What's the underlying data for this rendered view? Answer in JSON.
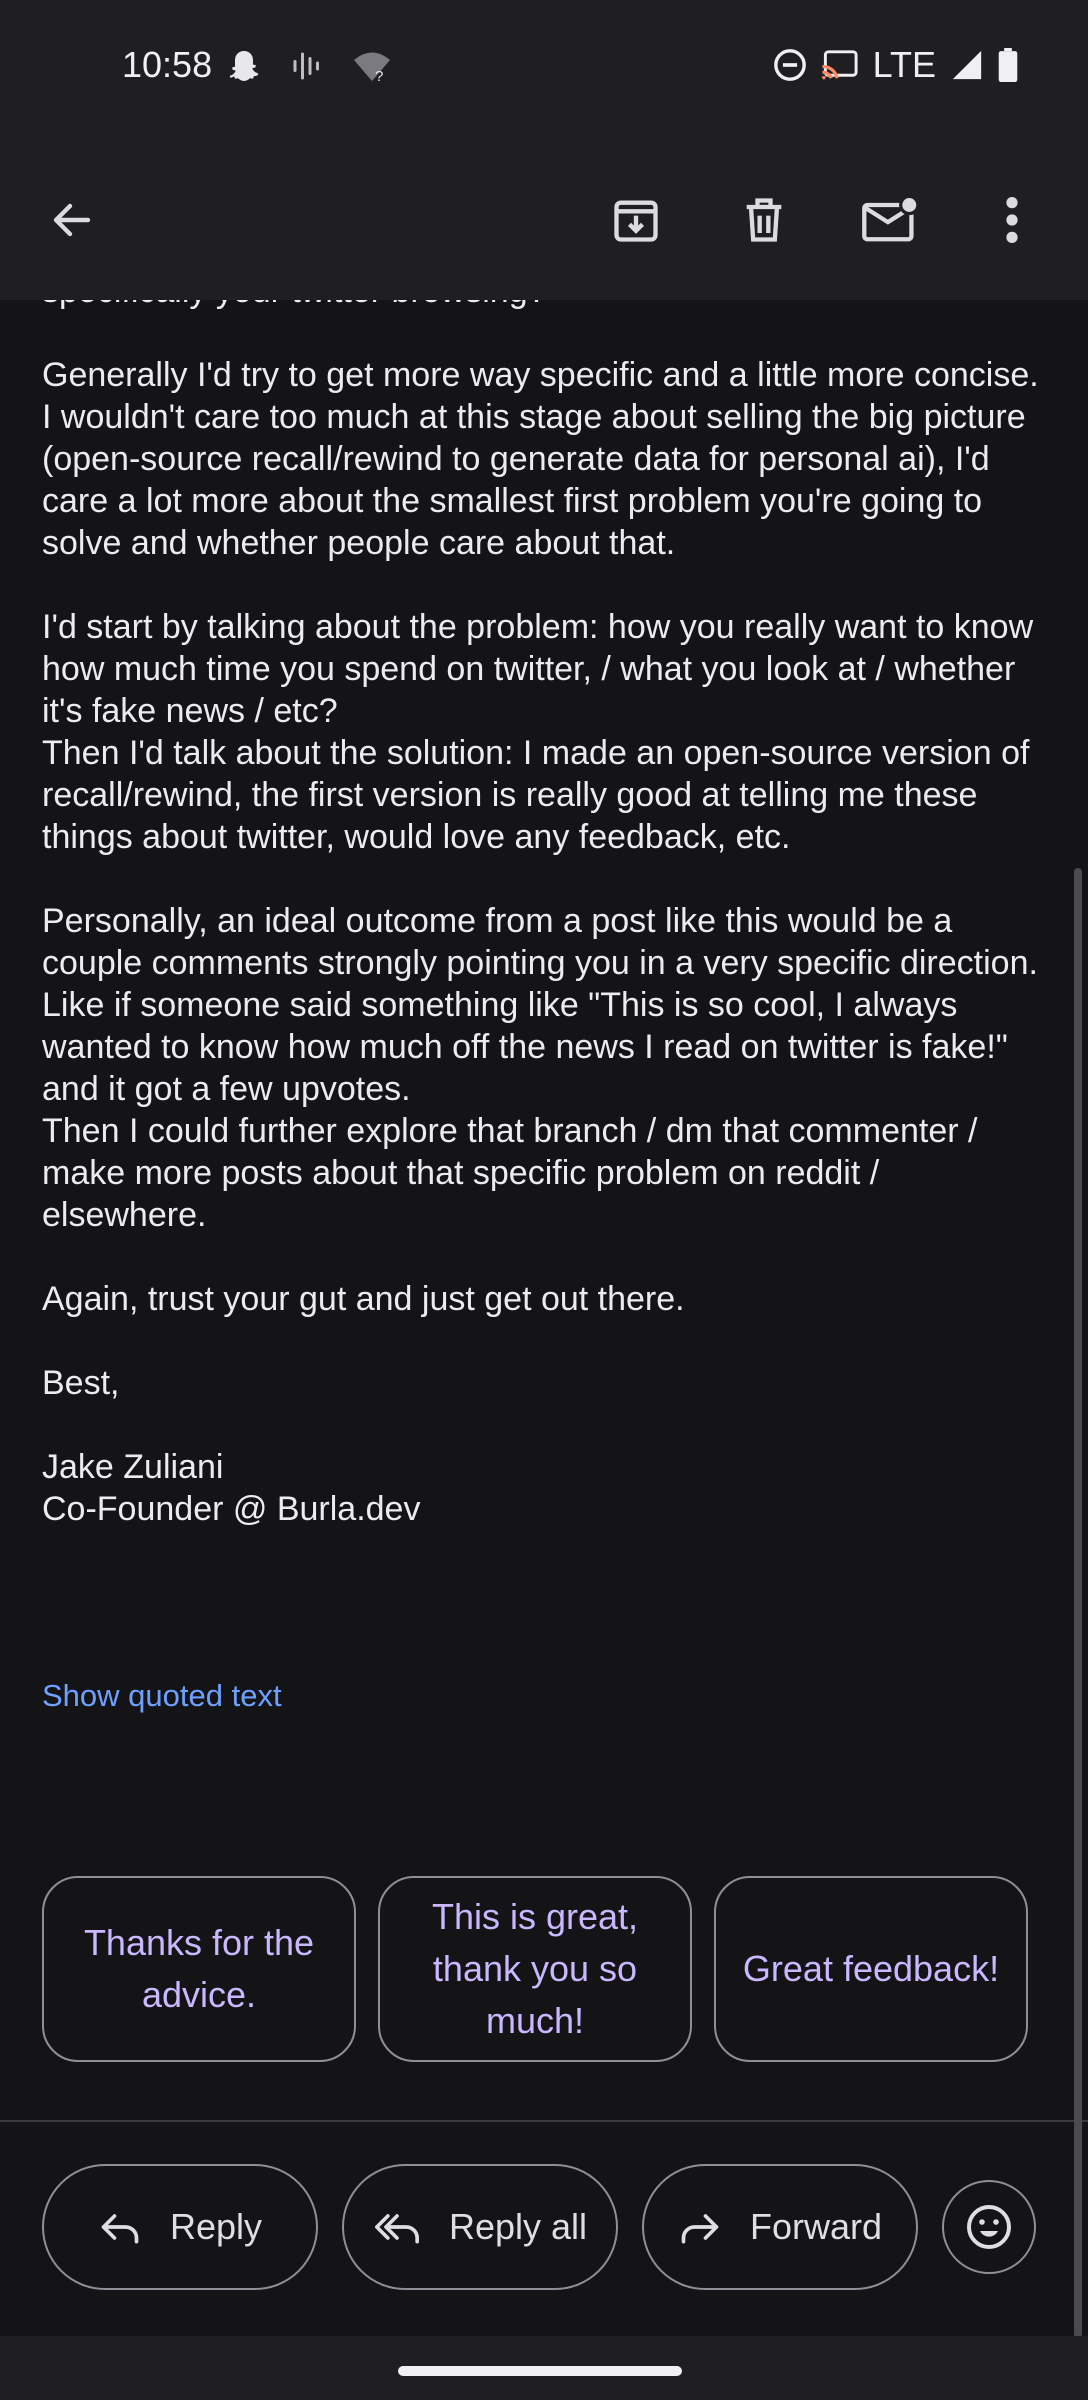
{
  "status_bar": {
    "time": "10:58",
    "network": "LTE",
    "icons": [
      "snapchat-icon",
      "voice-icon",
      "wifi-question-icon",
      "dnd-icon",
      "cast-icon",
      "signal-icon",
      "battery-icon"
    ]
  },
  "toolbar": {
    "icons": [
      "back-icon",
      "archive-icon",
      "delete-icon",
      "mark-unread-icon",
      "more-icon"
    ]
  },
  "email": {
    "cut_line": "specifically your twitter browsing?",
    "paragraphs": [
      "Generally I'd try to get more way specific and a little more concise. I wouldn't care too much at this stage about selling the big picture (open-source recall/rewind to generate data for personal ai), I'd care a lot more about the smallest first problem you're going to solve and whether people care about that.",
      "I'd start by talking about the problem: how you really want to know how much time you spend on twitter, / what you look at / whether it's fake news / etc?\nThen I'd talk about the solution: I made an open-source version of recall/rewind, the first version is really good at telling me these things about twitter, would love any feedback, etc.",
      "Personally, an ideal outcome from a post like this would be a couple comments strongly pointing you in a very specific direction. Like if someone said something like \"This is so cool, I always wanted to know how much off the news I read on twitter is fake!\" and it got a few upvotes.\nThen I could further explore that branch / dm that commenter / make more posts about that specific problem on reddit / elsewhere.",
      "Again, trust your gut and just get out there.",
      "Best,",
      "Jake Zuliani\nCo-Founder @ Burla.dev"
    ],
    "show_quoted": "Show quoted text"
  },
  "smart_replies": [
    "Thanks for the advice.",
    "This is great, thank you so much!",
    "Great feedback!"
  ],
  "actions": {
    "reply": "Reply",
    "reply_all": "Reply all",
    "forward": "Forward"
  },
  "colors": {
    "background": "#141417",
    "bars": "#1f1f22",
    "chip_text": "#c9b8ff",
    "link": "#6ea1ff"
  }
}
